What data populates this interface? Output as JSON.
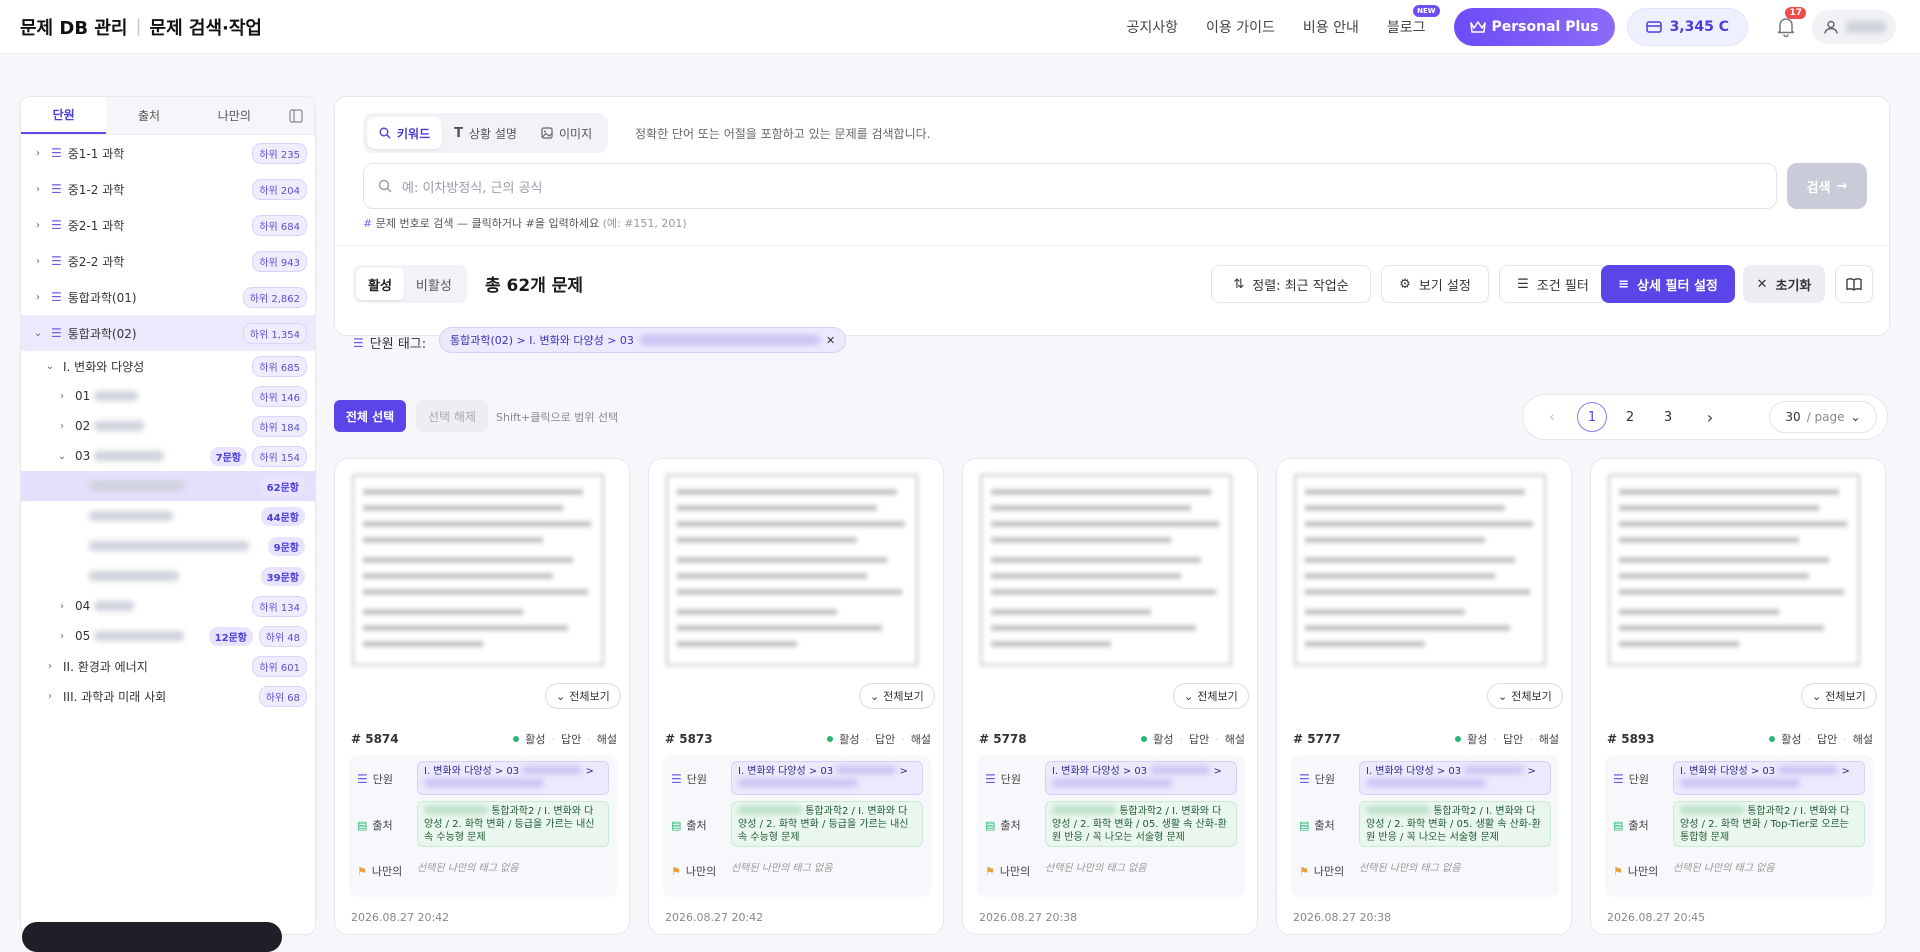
{
  "header": {
    "title": "문제 DB 관리",
    "subtitle": "문제 검색·작업",
    "nav": [
      "공지사항",
      "이용 가이드",
      "비용 안내",
      "블로그"
    ],
    "blog_badge": "NEW",
    "plan": "Personal Plus",
    "credits": "3,345 C",
    "notifications": "17"
  },
  "sidebar": {
    "tabs": [
      "단원",
      "출처",
      "나만의"
    ],
    "items": [
      {
        "label": "중1-1 과학",
        "count": "하위 235"
      },
      {
        "label": "중1-2 과학",
        "count": "하위 204"
      },
      {
        "label": "중2-1 과학",
        "count": "하위 684"
      },
      {
        "label": "중2-2 과학",
        "count": "하위 943"
      },
      {
        "label": "통합과학(01)",
        "count": "하위 2,862"
      },
      {
        "label": "통합과학(02)",
        "count": "하위 1,354"
      }
    ],
    "sub": {
      "i1": {
        "label": "I. 변화와 다양성",
        "count": "하위 685"
      },
      "c01": {
        "label": "01",
        "count": "하위 146"
      },
      "c02": {
        "label": "02",
        "count": "하위 184"
      },
      "c03": {
        "label": "03",
        "q": "7문항",
        "count": "하위 154"
      },
      "l1": {
        "q": "62문항"
      },
      "l2": {
        "q": "44문항"
      },
      "l3": {
        "q": "9문항"
      },
      "l4": {
        "q": "39문항"
      },
      "c04": {
        "label": "04",
        "count": "하위 134"
      },
      "c05": {
        "label": "05",
        "q": "12문항",
        "count": "하위 48"
      },
      "i2": {
        "label": "II. 환경과 에너지",
        "count": "하위 601"
      },
      "i3": {
        "label": "III. 과학과 미래 사회",
        "count": "하위 68"
      }
    }
  },
  "search": {
    "modes": [
      "키워드",
      "상황 설명",
      "이미지"
    ],
    "hint": "정확한 단어 또는 어절을 포함하고 있는 문제를 검색합니다.",
    "placeholder": "예: 이차방정식, 근의 공식",
    "button": "검색",
    "number_hint": "문제 번호로 검색 — 클릭하거나 #을 입력하세요",
    "number_example": "(예: #151, 201)"
  },
  "toolbar": {
    "active": "활성",
    "inactive": "비활성",
    "total": "총 62개 문제",
    "sort": "정렬: 최근 작업순",
    "view": "보기 설정",
    "filter": "조건 필터",
    "detail": "상세 필터 설정",
    "reset": "초기화"
  },
  "unit_tag": {
    "label": "단원 태그:",
    "chip": "통합과학(02) > I. 변화와 다양성 > 03"
  },
  "selection": {
    "select_all": "전체 선택",
    "clear": "선택 해제",
    "hint": "Shift+클릭으로 범위 선택"
  },
  "pager": {
    "pages": [
      "1",
      "2",
      "3"
    ],
    "per_page": "30",
    "per_page_unit": "/ page"
  },
  "card_labels": {
    "fullview": "전체보기",
    "status": "활성",
    "answer": "답안",
    "solution": "해설",
    "unit": "단원",
    "source": "출처",
    "mine": "나만의",
    "mine_empty": "선택된 나만의 태그 없음"
  },
  "cards": [
    {
      "id": "# 5874",
      "unit": "I. 변화와 다양성 > 03",
      "source": "통합과학2 / I. 변화와 다양성 / 2. 화학 변화 / 등급을 가르는 내신 속 수능형 문제",
      "date": "2026.08.27 20:42"
    },
    {
      "id": "# 5873",
      "unit": "I. 변화와 다양성 > 03",
      "source": "통합과학2 / I. 변화와 다양성 / 2. 화학 변화 / 등급을 가르는 내신 속 수능형 문제",
      "date": "2026.08.27 20:42"
    },
    {
      "id": "# 5778",
      "unit": "I. 변화와 다양성 > 03",
      "source": "통합과학2 / I. 변화와 다양성 / 2. 화학 변화 / 05. 생활 속 산화-환원 반응 / 꼭 나오는 서술형 문제",
      "date": "2026.08.27 20:38"
    },
    {
      "id": "# 5777",
      "unit": "I. 변화와 다양성 > 03",
      "source": "통합과학2 / I. 변화와 다양성 / 2. 화학 변화 / 05. 생활 속 산화-환원 반응 / 꼭 나오는 서술형 문제",
      "date": "2026.08.27 20:38"
    },
    {
      "id": "# 5893",
      "unit": "I. 변화와 다양성 > 03",
      "source": "통합과학2 / I. 변화와 다양성 / 2. 화학 변화 / Top-Tier로 오르는 통합형 문제",
      "date": "2026.08.27 20:45"
    }
  ]
}
